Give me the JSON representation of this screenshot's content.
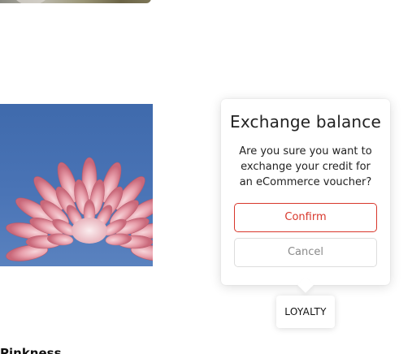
{
  "dialog": {
    "title": "Exchange balance",
    "message": "Are you sure you want to exchange your credit for an eCommerce voucher?",
    "confirm_label": "Confirm",
    "cancel_label": "Cancel"
  },
  "loyalty_tab": {
    "label": "LOYALTY"
  },
  "content": {
    "partial_heading": "Pinkness"
  },
  "colors": {
    "confirm_accent": "#d8372b",
    "cancel_border": "#dddddd",
    "sky": "#4a74b6",
    "petal": "#e9a1ad"
  },
  "images": {
    "top_image": "photo-strip",
    "flower_image": "pink-dahlia-photo"
  }
}
